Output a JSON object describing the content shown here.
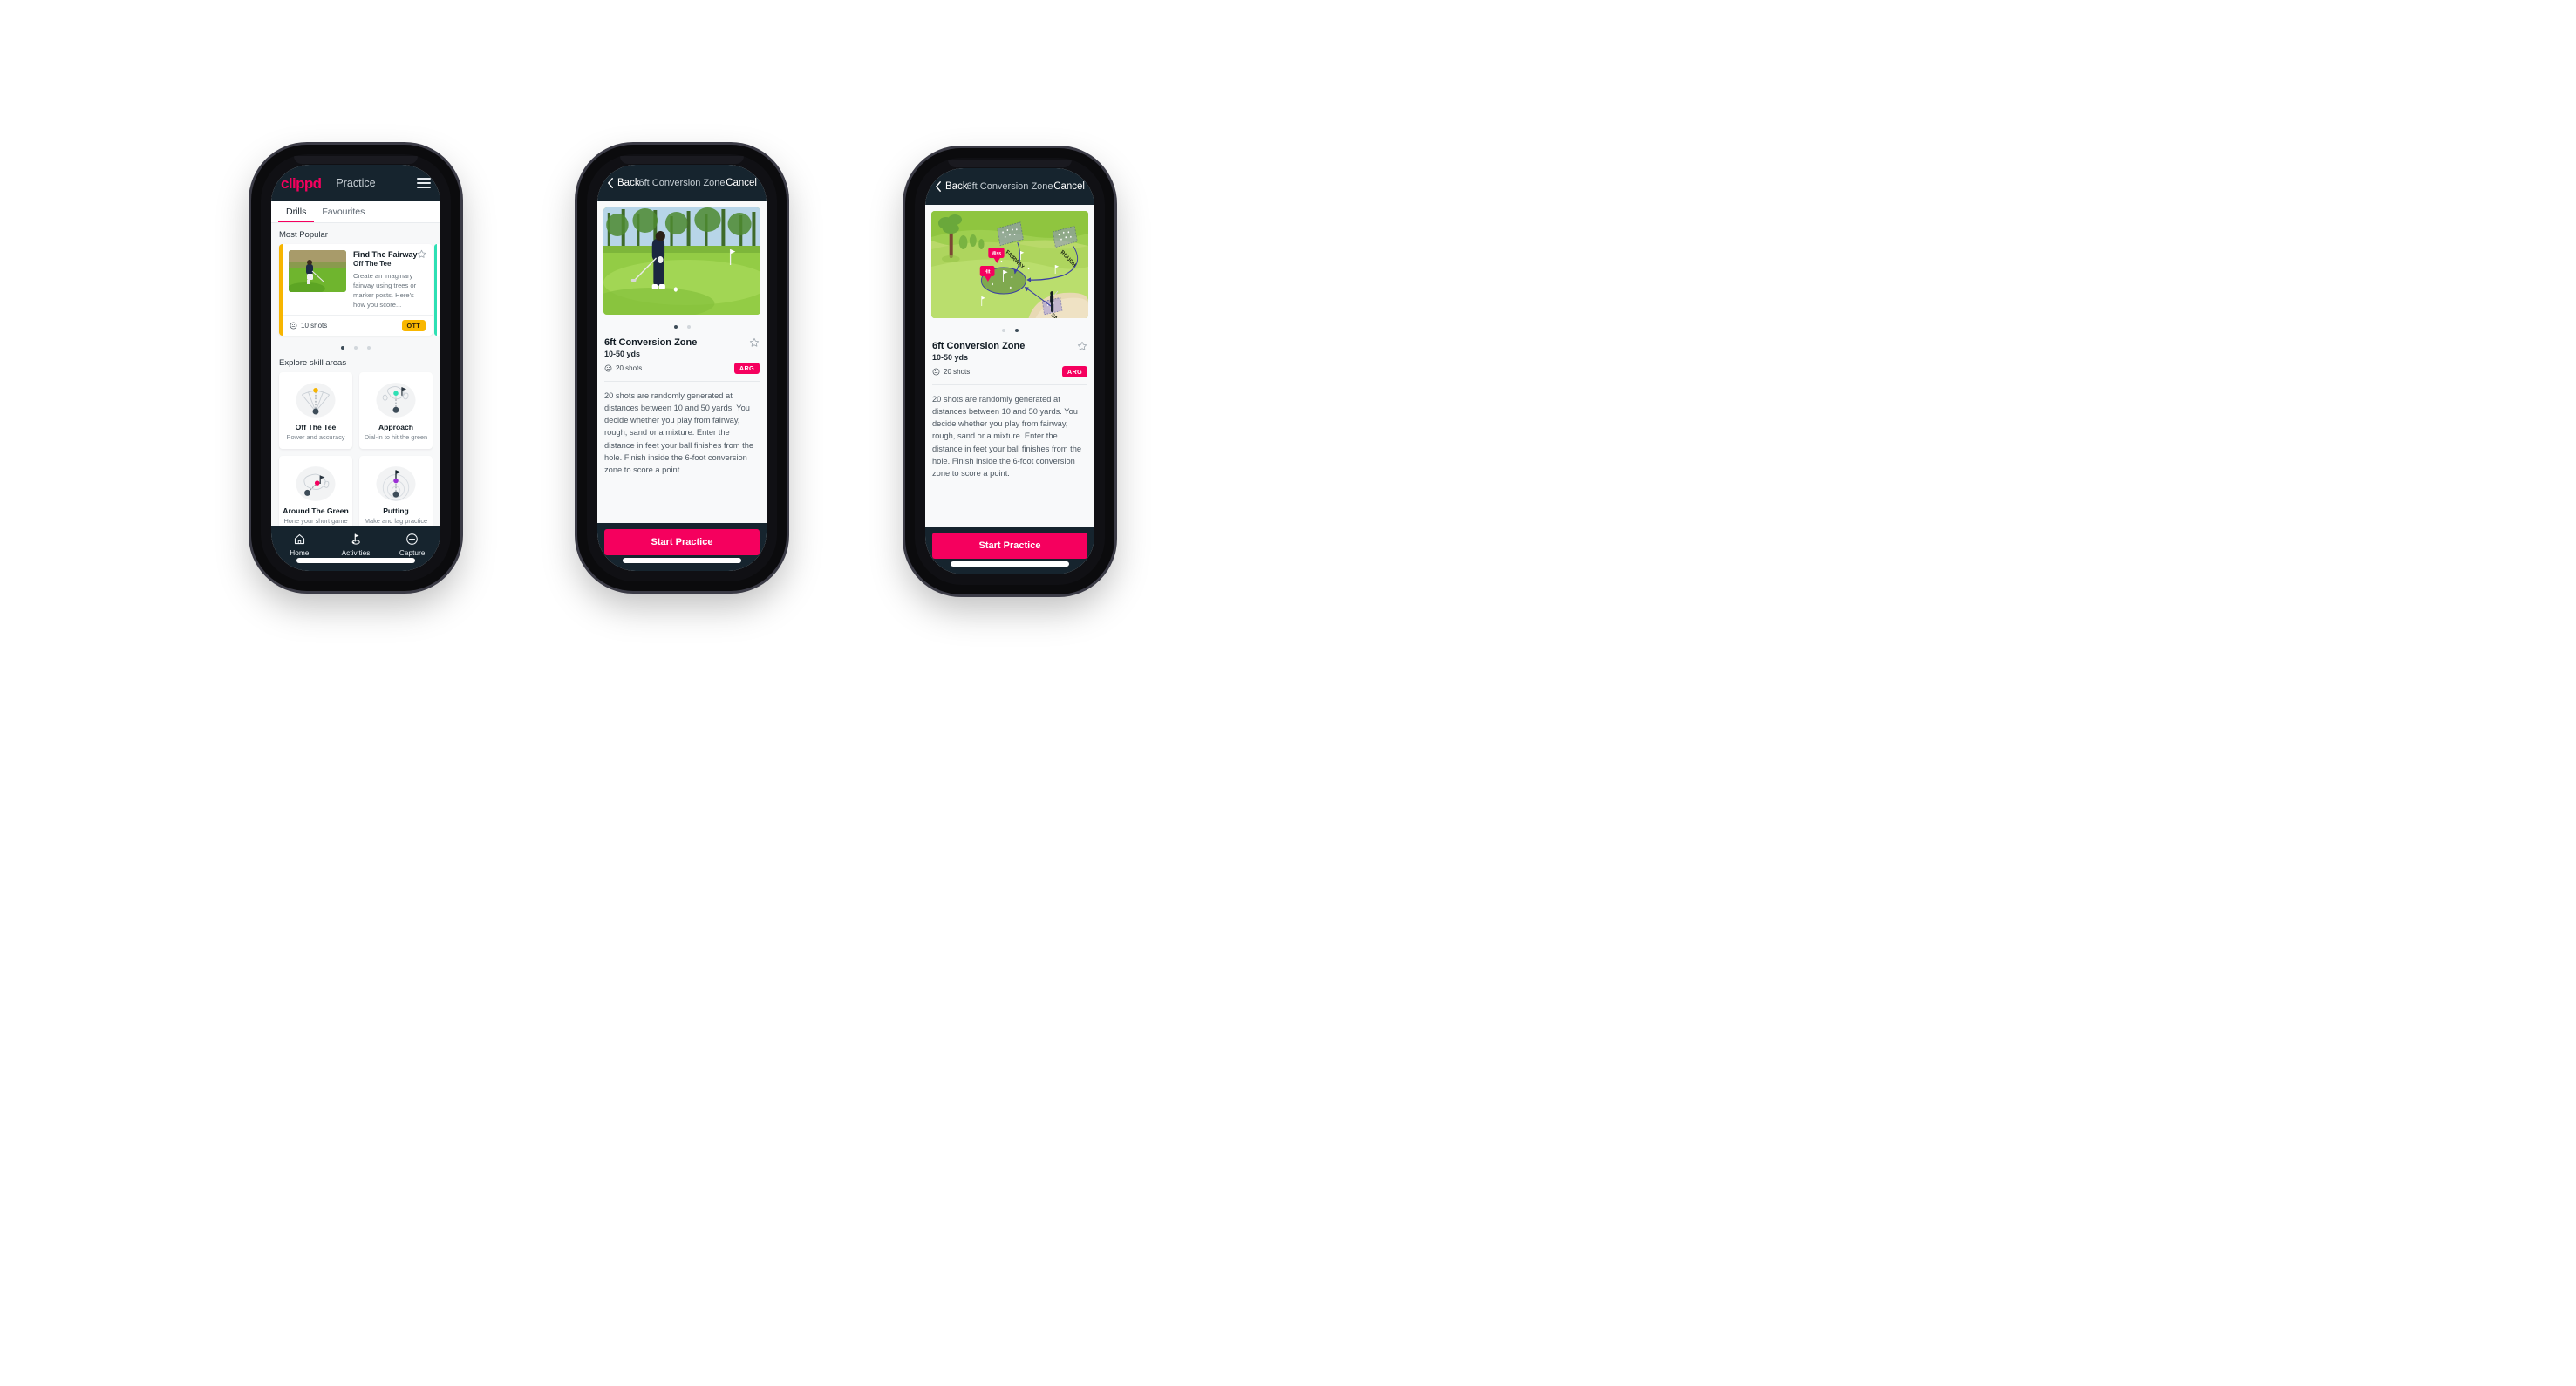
{
  "colors": {
    "brand_pink": "#f5005e",
    "nav_dark": "#16242e",
    "badge_ott": "#f9b700",
    "badge_arg": "#f5005e",
    "accent_teal": "#2ee0b4",
    "page_bg": "#f7f8f9"
  },
  "phone1": {
    "appbar": {
      "logo": "clippd",
      "title": "Practice",
      "menu_icon": "hamburger-icon"
    },
    "tabs": [
      {
        "label": "Drills",
        "active": true
      },
      {
        "label": "Favourites",
        "active": false
      }
    ],
    "sections": {
      "most_popular": "Most Popular",
      "explore": "Explore skill areas"
    },
    "drill_card": {
      "title": "Find The Fairway",
      "category": "Off The Tee",
      "description": "Create an imaginary fairway using trees or marker posts. Here's how you score...",
      "shots": "10 shots",
      "badge": "OTT",
      "favourite_icon": "star-outline-icon",
      "shots_icon": "target-icon",
      "accent": "#f9b700"
    },
    "carousel_dots": [
      true,
      false,
      false
    ],
    "skills": [
      {
        "name": "Off The Tee",
        "desc": "Power and accuracy",
        "icon": "off-the-tee-icon",
        "dot": "#f7b500"
      },
      {
        "name": "Approach",
        "desc": "Dial-in to hit the green",
        "icon": "approach-icon",
        "dot": "#2ee0b4"
      },
      {
        "name": "Around The Green",
        "desc": "Hone your short game",
        "icon": "around-the-green-icon",
        "dot": "#f5005e"
      },
      {
        "name": "Putting",
        "desc": "Make and lag practice",
        "icon": "putting-icon",
        "dot": "#9b2fd4"
      }
    ],
    "bottom_nav": [
      {
        "label": "Home",
        "icon": "home-icon",
        "active": false
      },
      {
        "label": "Activities",
        "icon": "golf-flag-icon",
        "active": true
      },
      {
        "label": "Capture",
        "icon": "plus-circle-icon",
        "active": false
      }
    ]
  },
  "phone2": {
    "navbar": {
      "back": "Back",
      "back_icon": "chevron-left-icon",
      "title": "6ft Conversion Zone",
      "cancel": "Cancel"
    },
    "media": {
      "type": "photo",
      "alt": "golfer-chipping-photo"
    },
    "carousel_dots": [
      true,
      false
    ],
    "detail": {
      "title": "6ft Conversion Zone",
      "subtitle": "10-50 yds",
      "shots": "20 shots",
      "shots_icon": "target-icon",
      "badge": "ARG",
      "favourite_icon": "star-outline-icon",
      "description": "20 shots are randomly generated at distances between 10 and 50 yards. You decide whether you play from fairway, rough, sand or a mixture. Enter the distance in feet your ball finishes from the hole. Finish inside the 6-foot conversion zone to score a point."
    },
    "cta": "Start Practice"
  },
  "phone3": {
    "navbar": {
      "back": "Back",
      "back_icon": "chevron-left-icon",
      "title": "6ft Conversion Zone",
      "cancel": "Cancel"
    },
    "media": {
      "type": "illustration",
      "alt": "golf-course-diagram",
      "labels": {
        "fairway": "FAIRWAY",
        "rough": "ROUGH",
        "sand": "SAND",
        "miss": "Miss",
        "hit": "Hit"
      }
    },
    "carousel_dots": [
      false,
      true
    ],
    "detail": {
      "title": "6ft Conversion Zone",
      "subtitle": "10-50 yds",
      "shots": "20 shots",
      "shots_icon": "target-icon",
      "badge": "ARG",
      "favourite_icon": "star-outline-icon",
      "description": "20 shots are randomly generated at distances between 10 and 50 yards. You decide whether you play from fairway, rough, sand or a mixture. Enter the distance in feet your ball finishes from the hole. Finish inside the 6-foot conversion zone to score a point."
    },
    "cta": "Start Practice"
  }
}
